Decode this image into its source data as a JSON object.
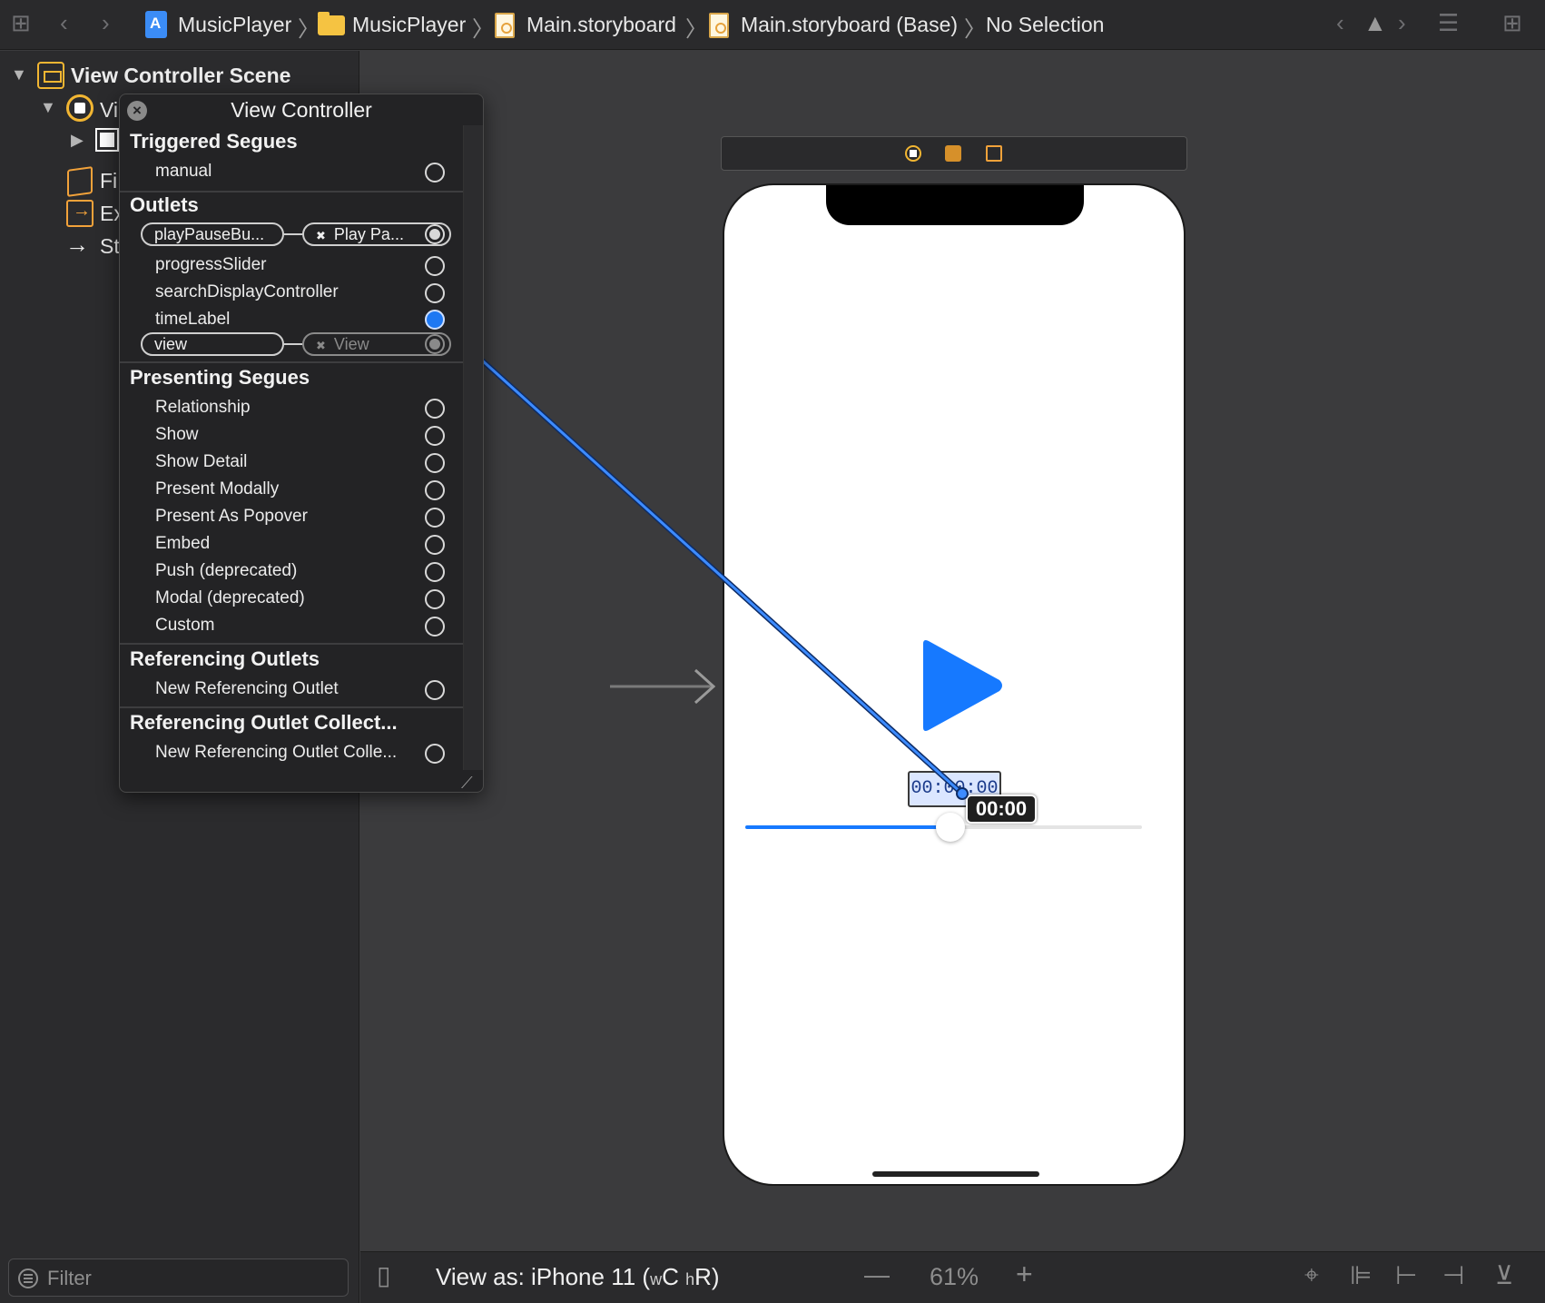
{
  "breadcrumb": {
    "items": [
      "MusicPlayer",
      "MusicPlayer",
      "Main.storyboard",
      "Main.storyboard (Base)",
      "No Selection"
    ]
  },
  "navigator": {
    "scene_title": "View Controller Scene",
    "items": [
      "Vi",
      "Fi",
      "Ex",
      "St"
    ],
    "filter_placeholder": "Filter"
  },
  "hud": {
    "title": "View Controller",
    "sections": {
      "triggered": "Triggered Segues",
      "outlets": "Outlets",
      "presenting": "Presenting Segues",
      "referencing": "Referencing Outlets",
      "referencing_collections": "Referencing Outlet Collect..."
    },
    "triggered_segues": [
      "manual"
    ],
    "outlets": {
      "play_pause_name": "playPauseBu...",
      "play_pause_target": "Play Pa...",
      "progress_slider": "progressSlider",
      "search_display": "searchDisplayController",
      "time_label": "timeLabel",
      "view_name": "view",
      "view_target": "View"
    },
    "presenting_segues": [
      "Relationship",
      "Show",
      "Show Detail",
      "Present Modally",
      "Present As Popover",
      "Embed",
      "Push (deprecated)",
      "Modal (deprecated)",
      "Custom"
    ],
    "new_referencing_outlet": "New Referencing Outlet",
    "new_referencing_collection": "New Referencing Outlet Colle..."
  },
  "device": {
    "time_label_text": "00:00:00",
    "drag_badge": "00:00",
    "slider_value": 0.5
  },
  "bottombar": {
    "view_as_prefix": "View as: iPhone 11 (",
    "size_w": "w",
    "size_c": "C",
    "size_h": "h",
    "size_r": "R)",
    "zoom": "61%"
  },
  "colors": {
    "accent_blue": "#1679ff",
    "storyboard_orange": "#f2b632"
  }
}
